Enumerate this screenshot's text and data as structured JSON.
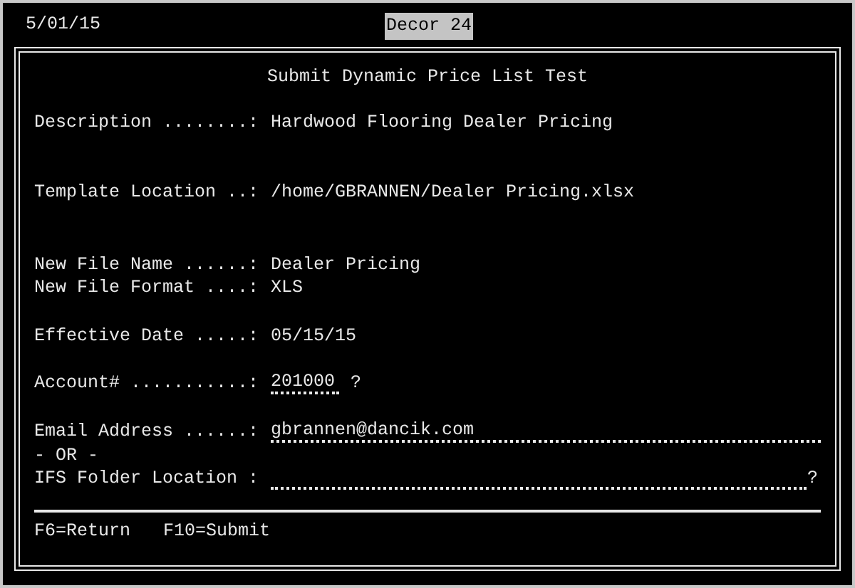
{
  "header": {
    "date": "5/01/15",
    "system": "Decor 24"
  },
  "screen": {
    "title": "Submit Dynamic Price List Test",
    "fields": [
      {
        "kind": "text",
        "label": "Description ........:",
        "value": "Hardwood Flooring Dealer Pricing"
      },
      {
        "kind": "text",
        "label": "Template Location ..:",
        "value": "/home/GBRANNEN/Dealer Pricing.xlsx"
      },
      {
        "kind": "text",
        "label": "New File Name ......:",
        "value": "Dealer Pricing"
      },
      {
        "kind": "text",
        "label": "New File Format ....:",
        "value": "XLS"
      },
      {
        "kind": "text",
        "label": "Effective Date .....:",
        "value": "05/15/15"
      },
      {
        "kind": "input",
        "label": "Account# ...........:",
        "value": "201000",
        "prompt": "?"
      },
      {
        "kind": "input",
        "label": "Email Address ......:",
        "value": "gbrannen@dancik.com"
      },
      {
        "kind": "note",
        "label": "- OR -"
      },
      {
        "kind": "input",
        "label": "IFS Folder Location :",
        "prompt": "?"
      }
    ],
    "function_keys": [
      "F6=Return",
      "F10=Submit"
    ]
  }
}
